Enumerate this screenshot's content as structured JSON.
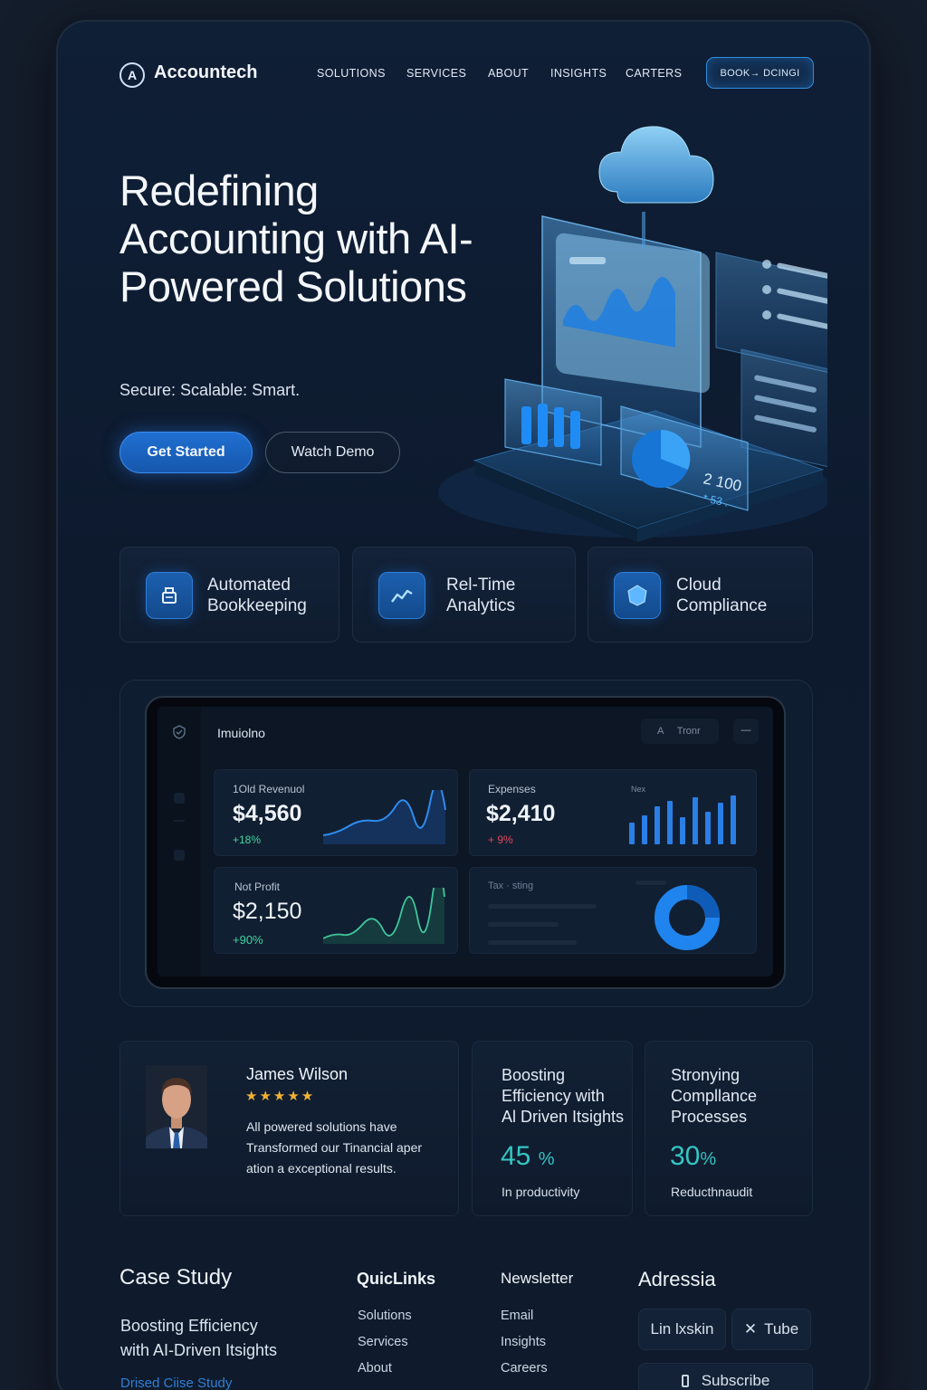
{
  "nav": {
    "brand": "Accountech",
    "links": [
      "SOLUTIONS",
      "SERVICES",
      "ABOUT",
      "INSIGHTS",
      "CARTERS"
    ],
    "cta": "BOOK→ DCINGI"
  },
  "hero": {
    "title": "Redefining Accounting with AI-Powered Solutions",
    "subtitle": "Secure: Scalable: Smart.",
    "primary_button": "Get Started",
    "secondary_button": "Watch Demo",
    "art": {
      "value": "2 100",
      "sub": "* 53 ."
    }
  },
  "features": [
    {
      "label": "Automated Bookkeeping",
      "icon": "document-icon"
    },
    {
      "label": "Rel-Time Analytics",
      "icon": "trend-icon"
    },
    {
      "label": "Cloud Compliance",
      "icon": "shield-icon"
    }
  ],
  "dashboard": {
    "title": "Imuiolno",
    "search_placeholder": "A     Tronr",
    "menu_glyph": "—",
    "cards": {
      "revenue": {
        "label": "1Old Revenuol",
        "value": "$4,560",
        "delta": "+18%"
      },
      "expenses": {
        "label": "Expenses",
        "value": "$2,410",
        "delta": "+ 9%",
        "chart_label": "Nex"
      },
      "profit": {
        "label": "Not Profit",
        "value": "$2,150",
        "delta": "+90%"
      },
      "tax": {
        "label": "Tax · sting"
      }
    },
    "colors": {
      "accent": "#2f8cf0",
      "positive": "#3fd6a0",
      "negative": "#e0475c"
    }
  },
  "testimonial": {
    "name": "James Wilson",
    "stars": 5,
    "quote_lines": [
      "All powered solutions have",
      "Transformed our Tinancial aper",
      "ation a exceptional results."
    ]
  },
  "stats": [
    {
      "title_lines": [
        "Boosting",
        "Efficiency with",
        "Al Driven Itsights"
      ],
      "number": "45",
      "unit": "%",
      "caption": "In productivity"
    },
    {
      "title_lines": [
        "Stronying",
        "Compllance",
        "Processes"
      ],
      "number": "30",
      "unit": "%",
      "caption": "Reducthnaudit"
    }
  ],
  "footer": {
    "case_study": {
      "heading": "Case Study",
      "text_lines": [
        "Boosting Efficiency",
        "with AI-Driven Itsights"
      ],
      "link": "Drised Ciise Study"
    },
    "quicklinks": {
      "heading": "QuicLinks",
      "links": [
        "Solutions",
        "Services",
        "About"
      ]
    },
    "newsletter": {
      "heading": "Newsletter",
      "links": [
        "Email",
        "Insights",
        "Careers"
      ]
    },
    "address": {
      "heading": "Adressia",
      "social": [
        "Lin lxskin",
        "Tube"
      ],
      "subscribe": "Subscribe"
    }
  }
}
